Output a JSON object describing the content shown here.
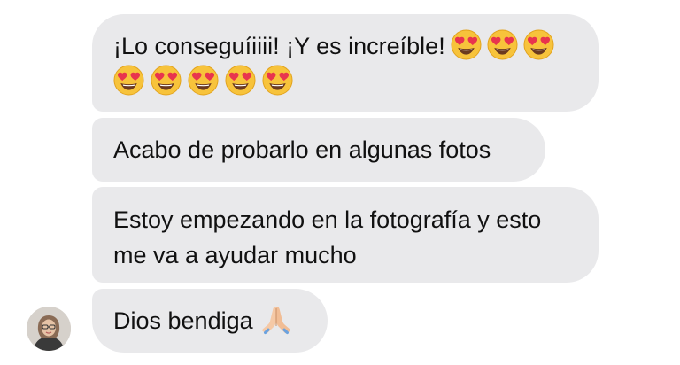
{
  "messages": [
    {
      "line1": "¡Lo conseguíiiii! ¡Y es increíble!",
      "inline_emoji_count": 3,
      "row_emoji_count": 5,
      "emoji": "smiling-face-with-heart-eyes"
    },
    {
      "text": "Acabo de probarlo en algunas fotos"
    },
    {
      "line1": "Estoy empezando en la fotografía y esto",
      "line2": "me va a ayudar mucho"
    },
    {
      "text": "Dios bendiga",
      "emoji": "folded-hands"
    }
  ],
  "sender": {
    "avatar": "profile-photo"
  },
  "colors": {
    "bubble": "#e9e9eb",
    "text": "#111111",
    "background": "#ffffff"
  }
}
